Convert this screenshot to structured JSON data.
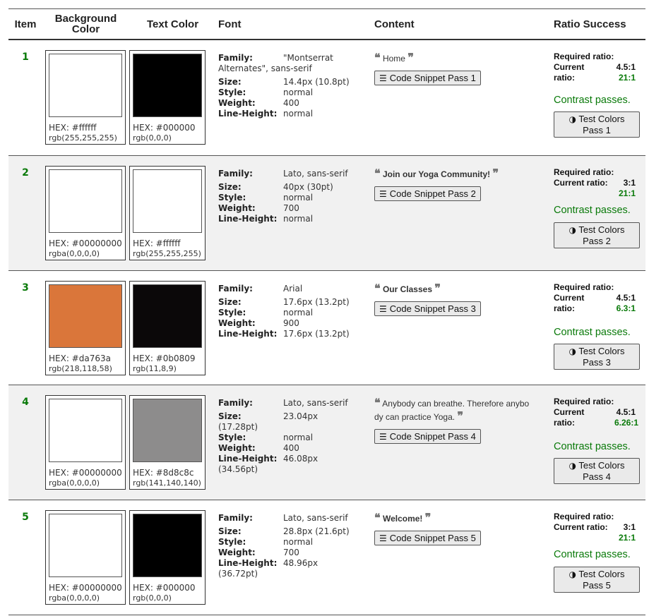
{
  "headers": {
    "item": "Item",
    "background": "Background Color",
    "text_color": "Text Color",
    "font": "Font",
    "content": "Content",
    "ratio": "Ratio Success"
  },
  "labels": {
    "family": "Family:",
    "size": "Size:",
    "style": "Style:",
    "weight": "Weight:",
    "line_height": "Line-Height:",
    "required": "Required ratio:",
    "current": "Current ratio:",
    "current_a": "Current",
    "ratio_word": "ratio:",
    "passes": "Contrast passes.",
    "test_colors": "Test Colors"
  },
  "rows": [
    {
      "num": "1",
      "bg_hex": "HEX: #ffffff",
      "bg_rgb": "rgb(255,255,255)",
      "bg_color": "#ffffff",
      "tc_hex": "HEX: #000000",
      "tc_rgb": "rgb(0,0,0)",
      "tc_color": "#000000",
      "family": "\"Montserrat Alternates\", sans-serif",
      "size": "14.4px (10.8pt)",
      "style": "normal",
      "weight": "400",
      "line_height": "normal",
      "content": "Home",
      "snippet": "Code Snippet Pass 1",
      "required": "4.5:1",
      "current": "21:1",
      "test": "Pass 1"
    },
    {
      "num": "2",
      "bg_hex": "HEX: #00000000",
      "bg_rgb": "rgba(0,0,0,0)",
      "bg_color": "#ffffff",
      "tc_hex": "HEX: #ffffff",
      "tc_rgb": "rgb(255,255,255)",
      "tc_color": "#ffffff",
      "family": "Lato, sans-serif",
      "size": "40px (30pt)",
      "style": "normal",
      "weight": "700",
      "line_height": "normal",
      "content": "Join our Yoga Community!",
      "snippet": "Code Snippet Pass 2",
      "required": "3:1",
      "current": "21:1",
      "test": "Pass 2"
    },
    {
      "num": "3",
      "bg_hex": "HEX: #da763a",
      "bg_rgb": "rgb(218,118,58)",
      "bg_color": "#da763a",
      "tc_hex": "HEX: #0b0809",
      "tc_rgb": "rgb(11,8,9)",
      "tc_color": "#0b0809",
      "family": "Arial",
      "size": "17.6px (13.2pt)",
      "style": "normal",
      "weight": "900",
      "line_height": "17.6px (13.2pt)",
      "content": "Our Classes",
      "snippet": "Code Snippet Pass 3",
      "required": "4.5:1",
      "current": "6.3:1",
      "test": "Pass 3"
    },
    {
      "num": "4",
      "bg_hex": "HEX: #00000000",
      "bg_rgb": "rgba(0,0,0,0)",
      "bg_color": "#ffffff",
      "tc_hex": "HEX: #8d8c8c",
      "tc_rgb": "rgb(141,140,140)",
      "tc_color": "#8d8c8c",
      "family": "Lato, sans-serif",
      "size": "23.04px",
      "size_b": "(17.28pt)",
      "style": "normal",
      "weight": "400",
      "line_height": "46.08px",
      "line_height_b": "(34.56pt)",
      "content_a": "Anybody can breathe. Therefore anybo",
      "content_b": "dy can practice Yoga.",
      "snippet": "Code Snippet Pass 4",
      "required": "4.5:1",
      "current": "6.26:1",
      "test": "Pass 4"
    },
    {
      "num": "5",
      "bg_hex": "HEX: #00000000",
      "bg_rgb": "rgba(0,0,0,0)",
      "bg_color": "#ffffff",
      "tc_hex": "HEX: #000000",
      "tc_rgb": "rgb(0,0,0)",
      "tc_color": "#000000",
      "family": "Lato, sans-serif",
      "size": "28.8px (21.6pt)",
      "style": "normal",
      "weight": "700",
      "line_height": "48.96px",
      "line_height_b": "(36.72pt)",
      "content": "Welcome!",
      "snippet": "Code Snippet Pass 5",
      "required": "3:1",
      "current": "21:1",
      "test": "Pass 5"
    }
  ],
  "icons": {
    "quote_open": "quote-open-icon",
    "quote_close": "quote-close-icon",
    "snippet": "lines-icon",
    "test": "contrast-icon"
  }
}
